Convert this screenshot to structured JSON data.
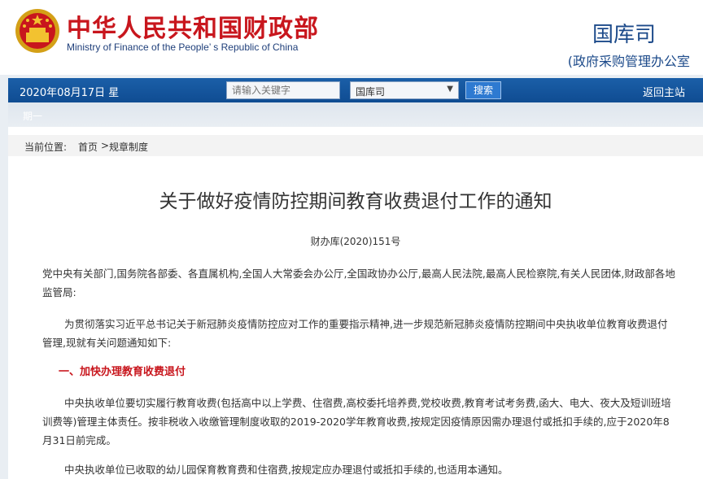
{
  "header": {
    "ministry_cn": "中华人民共和国财政部",
    "ministry_en": "Ministry of Finance of the People’ s Republic of China",
    "dept_name": "国库司",
    "dept_sub": "(政府采购管理办公室"
  },
  "navbar": {
    "date": "2020年08月17日 星",
    "search_placeholder": "请输入关键字",
    "select_value": "国库司",
    "search_button": "搜索",
    "home_link": "返回主站"
  },
  "weekday": "期一",
  "breadcrumb": {
    "label": "当前位置:",
    "home": "首页",
    "sep": ">",
    "current": "规章制度"
  },
  "article": {
    "title": "关于做好疫情防控期间教育收费退付工作的通知",
    "doc_number": "财办库(2020)151号",
    "p1": "党中央有关部门,国务院各部委、各直属机构,全国人大常委会办公厅,全国政协办公厅,最高人民法院,最高人民检察院,有关人民团体,财政部各地监管局:",
    "p2": "为贯彻落实习近平总书记关于新冠肺炎疫情防控应对工作的重要指示精神,进一步规范新冠肺炎疫情防控期间中央执收单位教育收费退付管理,现就有关问题通知如下:",
    "section1": "一、加快办理教育收费退付",
    "p3": "中央执收单位要切实履行教育收费(包括高中以上学费、住宿费,高校委托培养费,党校收费,教育考试考务费,函大、电大、夜大及短训班培训费等)管理主体责任。按非税收入收缴管理制度收取的2019-2020学年教育收费,按规定因疫情原因需办理退付或抵扣手续的,应于2020年8月31日前完成。",
    "p4": "中央执收单位已收取的幼儿园保育教育费和住宿费,按规定应办理退付或抵扣手续的,也适用本通知。"
  },
  "colors": {
    "brand_red": "#c8161d",
    "brand_blue": "#1c4a8a",
    "nav_blue": "#0f4c92"
  }
}
